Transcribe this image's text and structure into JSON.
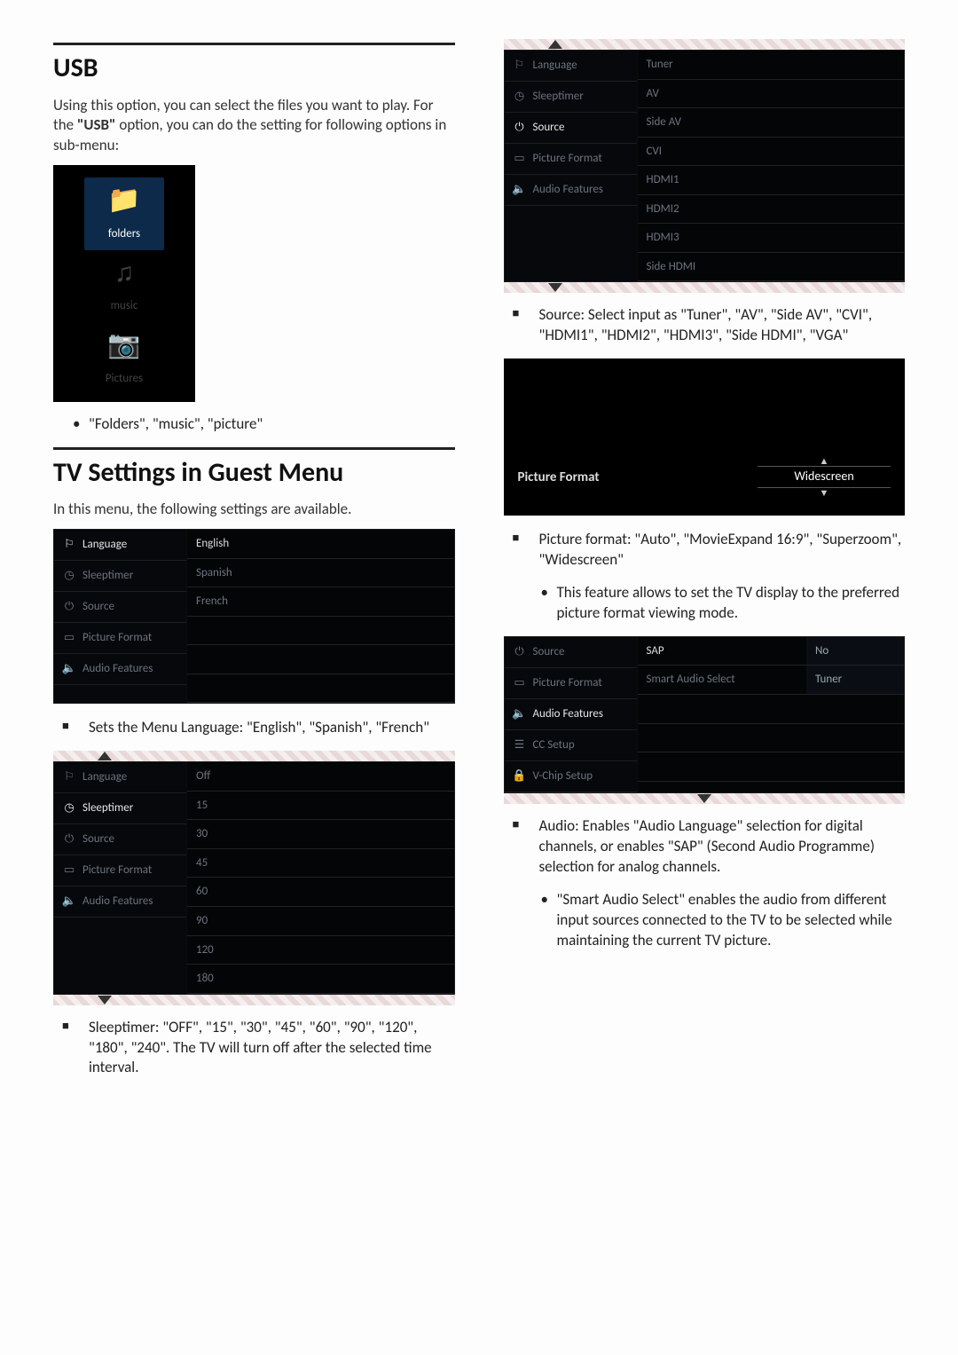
{
  "left": {
    "usb": {
      "title": "USB",
      "p1a": "Using this option, you can select the files you want to play. For the ",
      "p1b": "\"USB\"",
      "p1c": " option, you can do the setting for following options in sub-menu:",
      "tiles": {
        "folders": "folders",
        "music": "music",
        "pictures": "Pictures"
      },
      "bullet1": "\"Folders\", \"music\", \"picture\""
    },
    "tvset": {
      "title": "TV Settings in Guest Menu",
      "intro": "In this menu, the following settings are available.",
      "menuItems": {
        "language": "Language",
        "sleeptimer": "Sleeptimer",
        "source": "Source",
        "pictureformat": "Picture Format",
        "audiofeatures": "Audio Features"
      },
      "langOpts": {
        "english": "English",
        "spanish": "Spanish",
        "french": "French"
      },
      "sq1": "Sets the Menu Language: \"English\", \"Spanish\", \"French\"",
      "sleepOpts": {
        "off": "Off",
        "v15": "15",
        "v30": "30",
        "v45": "45",
        "v60": "60",
        "v90": "90",
        "v120": "120",
        "v180": "180"
      },
      "sq2": "Sleeptimer: \"OFF\", \"15\", \"30\", \"45\", \"60\", \"90\", \"120\", \"180\", \"240\". The TV will turn off after the selected time interval."
    }
  },
  "right": {
    "sourceOpts": {
      "tuner": "Tuner",
      "av": "AV",
      "sideav": "Side AV",
      "cvi": "CVI",
      "hdmi1": "HDMI1",
      "hdmi2": "HDMI2",
      "hdmi3": "HDMI3",
      "sidehdmi": "Side HDMI"
    },
    "sq_source": "Source: Select input as \"Tuner\", \"AV\", \"Side AV\", \"CVI\", \"HDMI1\", \"HDMI2\", \"HDMI3\", \"Side HDMI\", \"VGA\"",
    "pf": {
      "label": "Picture Format",
      "value": "Widescreen"
    },
    "sq_pf": "Picture format: \"Auto\", \"MovieExpand 16:9\", \"Superzoom\",  \"Widescreen\"",
    "pf_sub": "This feature allows to set the TV display to the preferred picture format viewing mode.",
    "audioMenu": {
      "source": "Source",
      "pictureformat": "Picture Format",
      "audiofeatures": "Audio Features",
      "ccsetup": "CC Setup",
      "vchip": "V-Chip Setup",
      "sap": "SAP",
      "sas": "Smart Audio Select",
      "no": "No",
      "tuner": "Tuner"
    },
    "sq_audio": "Audio: Enables \"Audio Language\" selection for digital channels, or enables \"SAP\" (Second Audio Programme) selection for analog channels.",
    "audio_sub": "\"Smart Audio Select\" enables the audio from different input sources connected to the TV to be selected while maintaining the current TV picture."
  }
}
